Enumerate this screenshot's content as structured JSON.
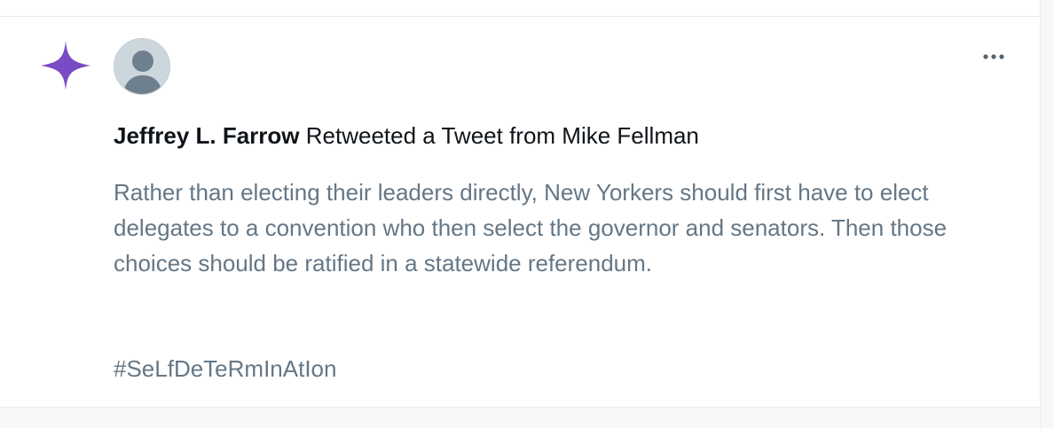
{
  "notification": {
    "icon": "sparkle-icon",
    "icon_color": "#794bc4",
    "avatar": "default-avatar-icon",
    "more_icon": "more-dots-icon",
    "author": "Jeffrey L. Farrow",
    "action": "Retweeted a Tweet from Mike Fellman",
    "tweet_text": "Rather than electing their leaders directly, New Yorkers should first have to elect delegates to a convention who then select the governor and senators. Then those choices should be ratified in a statewide referendum.",
    "hashtag": "#SeLfDeTeRmInAtIon"
  },
  "colors": {
    "primary_text": "#0f1419",
    "secondary_text": "#657786",
    "border": "#e6ecf0",
    "avatar_bg": "#ccd6dd",
    "avatar_fg": "#6e7f8d"
  }
}
